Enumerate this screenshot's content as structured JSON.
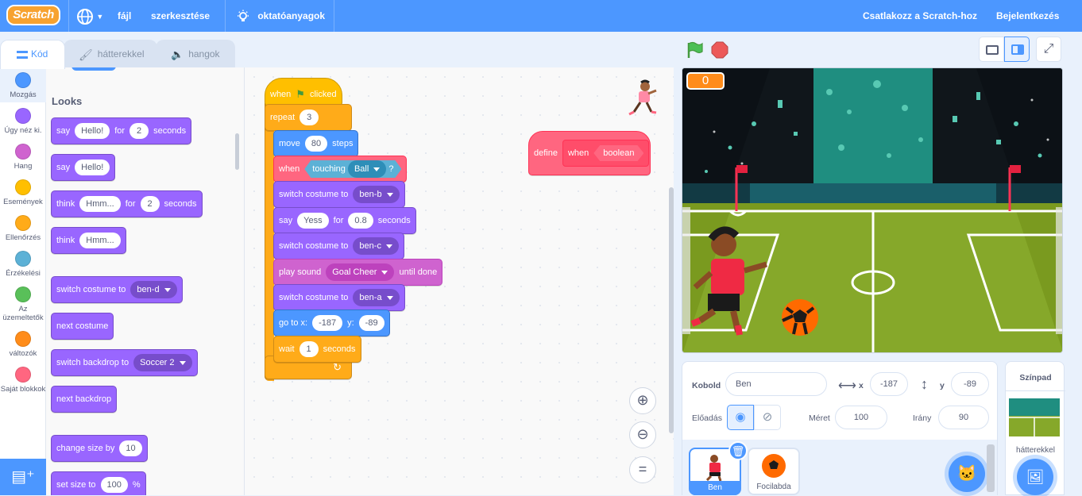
{
  "menu": {
    "logo": "Scratch",
    "file": "fájl",
    "edit": "szerkesztése",
    "tutorials": "oktatóanyagok",
    "join": "Csatlakozz a Scratch-hoz",
    "signin": "Bejelentkezés"
  },
  "tabs": {
    "code": "Kód",
    "backdrops": "hátterekkel",
    "sounds": "hangok"
  },
  "categories": [
    {
      "label": "Mozgás",
      "color": "#4c97ff"
    },
    {
      "label": "Úgy néz ki.",
      "color": "#9966ff"
    },
    {
      "label": "Hang",
      "color": "#cf63cf"
    },
    {
      "label": "Események",
      "color": "#ffbf00"
    },
    {
      "label": "Ellenőrzés",
      "color": "#ffab19"
    },
    {
      "label": "Érzékelési",
      "color": "#5cb1d6"
    },
    {
      "label": "Az üzemeltetők",
      "color": "#59c059"
    },
    {
      "label": "változók",
      "color": "#ff8c1a"
    },
    {
      "label": "Saját blokkok",
      "color": "#ff6680"
    }
  ],
  "palette": {
    "heading": "Looks",
    "say_for": {
      "a": "say",
      "v1": "Hello!",
      "b": "for",
      "v2": "2",
      "c": "seconds"
    },
    "say": {
      "a": "say",
      "v1": "Hello!"
    },
    "think_for": {
      "a": "think",
      "v1": "Hmm...",
      "b": "for",
      "v2": "2",
      "c": "seconds"
    },
    "think": {
      "a": "think",
      "v1": "Hmm..."
    },
    "switch_costume": {
      "a": "switch costume to",
      "v1": "ben-d"
    },
    "next_costume": "next costume",
    "switch_backdrop": {
      "a": "switch backdrop to",
      "v1": "Soccer 2"
    },
    "next_backdrop": "next backdrop",
    "change_size": {
      "a": "change size by",
      "v1": "10"
    },
    "set_size": {
      "a": "set size to",
      "v1": "100",
      "b": "%"
    }
  },
  "script": {
    "hat": {
      "a": "when",
      "b": "clicked"
    },
    "repeat": {
      "a": "repeat",
      "v1": "3"
    },
    "move": {
      "a": "move",
      "v1": "80",
      "b": "steps"
    },
    "when_touching": {
      "a": "when",
      "b": "touching",
      "v1": "Ball",
      "c": "?"
    },
    "costume_b": {
      "a": "switch costume to",
      "v1": "ben-b"
    },
    "say": {
      "a": "say",
      "v1": "Yess",
      "b": "for",
      "v2": "0.8",
      "c": "seconds"
    },
    "costume_c": {
      "a": "switch costume to",
      "v1": "ben-c"
    },
    "sound": {
      "a": "play sound",
      "v1": "Goal Cheer",
      "b": "until done"
    },
    "costume_a": {
      "a": "switch costume to",
      "v1": "ben-a"
    },
    "goto": {
      "a": "go to x:",
      "v1": "-187",
      "b": "y:",
      "v2": "-89"
    },
    "wait": {
      "a": "wait",
      "v1": "1",
      "b": "seconds"
    },
    "define": {
      "a": "define",
      "b": "when",
      "c": "boolean"
    }
  },
  "stage": {
    "counter": "0"
  },
  "sprite_info": {
    "sprite_label": "Kobold",
    "name": "Ben",
    "x_label": "x",
    "x": "-187",
    "y_label": "y",
    "y": "-89",
    "show_label": "Előadás",
    "size_label": "Méret",
    "size": "100",
    "direction_label": "Irány",
    "direction": "90"
  },
  "sprites": [
    {
      "name": "Ben"
    },
    {
      "name": "Focilabda"
    }
  ],
  "stage_panel": {
    "title": "Színpad",
    "backdrops_label": "hátterekkel"
  },
  "colors": {
    "menu": "#4c97ff",
    "accent": "#ff8c1a"
  }
}
